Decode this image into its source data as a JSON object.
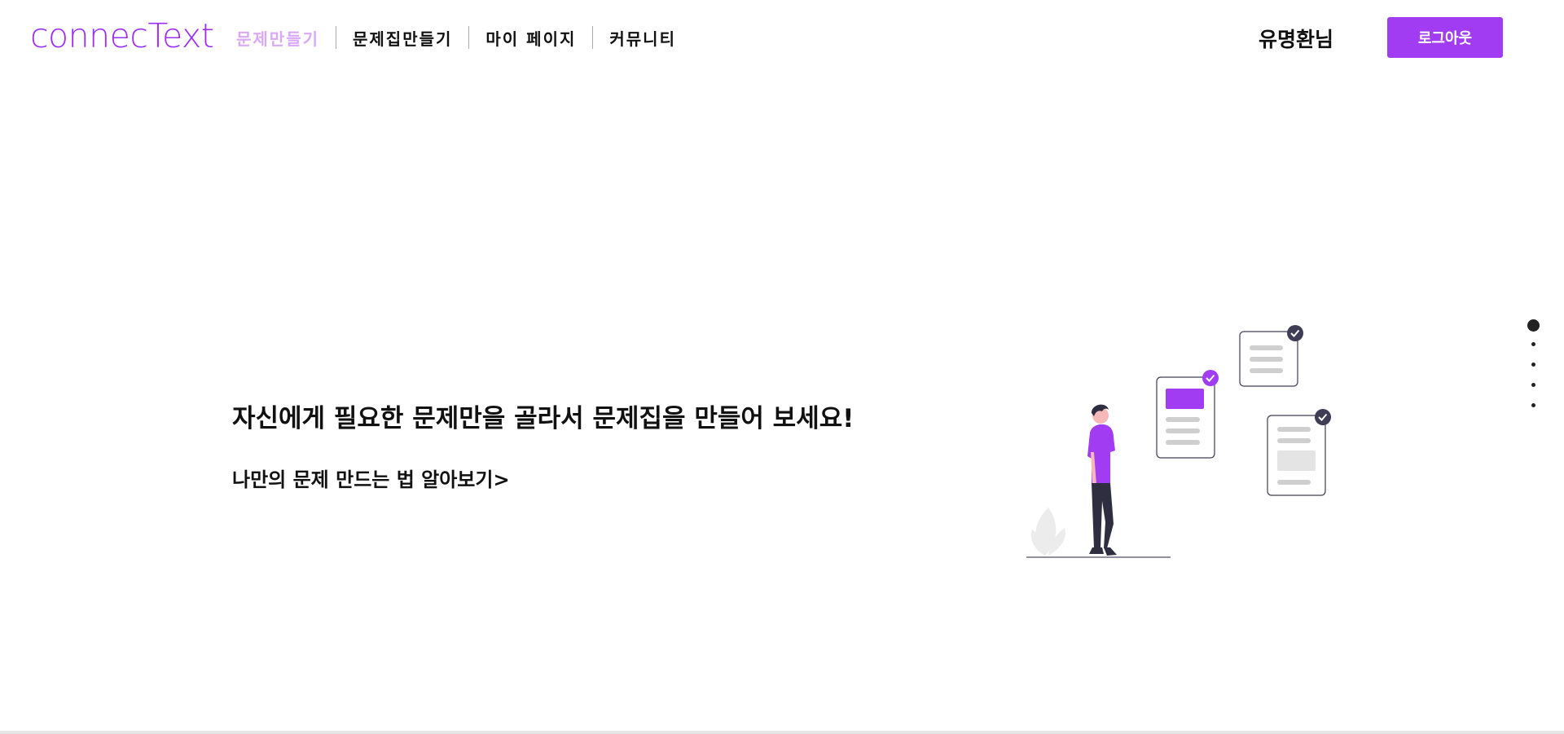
{
  "header": {
    "logo": "connecText",
    "nav": [
      {
        "label": "문제만들기",
        "active": true
      },
      {
        "label": "문제집만들기",
        "active": false
      },
      {
        "label": "마이 페이지",
        "active": false
      },
      {
        "label": "커뮤니티",
        "active": false
      }
    ],
    "username": "유명환님",
    "logout_label": "로그아웃"
  },
  "hero": {
    "title": "자신에게 필요한 문제만을 골라서 문제집을 만들어 보세요!",
    "link": "나만의 문제 만드는 법 알아보기>"
  },
  "pagination": {
    "total": 5,
    "current": 1
  },
  "colors": {
    "accent": "#a23cf2",
    "logo": "#9b30f4",
    "nav_active": "#d9a8f7"
  }
}
